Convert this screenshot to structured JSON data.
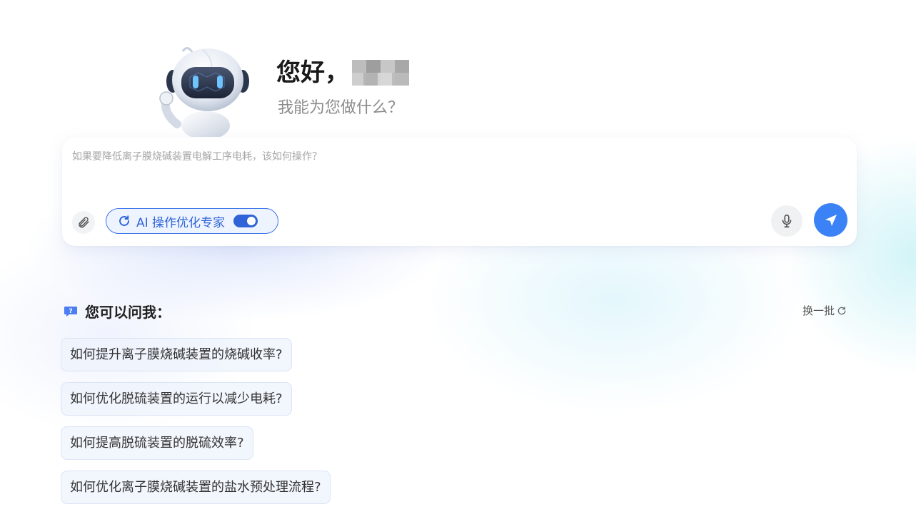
{
  "greeting": {
    "hello": "您好，",
    "subtitle": "我能为您做什么？"
  },
  "input": {
    "placeholder": "如果要降低离子膜烧碱装置电解工序电耗，该如何操作？"
  },
  "mode_chip": {
    "label": "AI 操作优化专家",
    "enabled": true
  },
  "suggestions": {
    "title": "您可以问我：",
    "refresh_label": "换一批",
    "items": [
      "如何提升离子膜烧碱装置的烧碱收率?",
      "如何优化脱硫装置的运行以减少电耗?",
      "如何提高脱硫装置的脱硫效率?",
      "如何优化离子膜烧碱装置的盐水预处理流程?"
    ]
  },
  "colors": {
    "accent": "#3b82f6",
    "chip_border": "#3b74e8",
    "chip_text": "#2f64d8"
  },
  "icons": {
    "attach": "paperclip-icon",
    "mode": "refresh-icon",
    "mic": "microphone-icon",
    "send": "send-icon",
    "help": "question-bubble-icon",
    "refresh": "refresh-icon"
  }
}
